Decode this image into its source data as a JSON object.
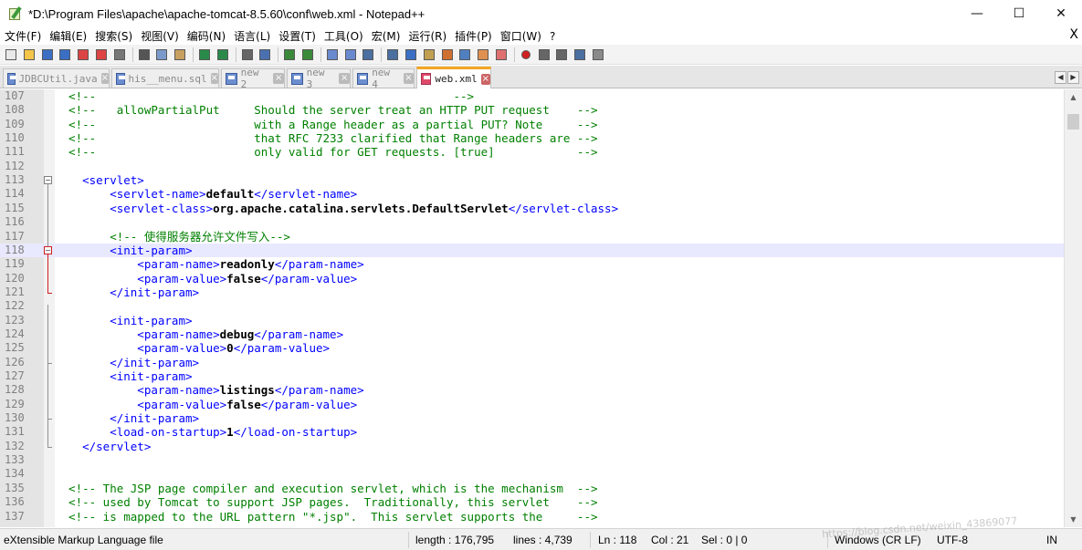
{
  "window": {
    "title": "*D:\\Program Files\\apache\\apache-tomcat-8.5.60\\conf\\web.xml - Notepad++",
    "minimize_glyph": "—",
    "maximize_glyph": "☐",
    "close_glyph": "✕"
  },
  "menu": {
    "items": [
      "文件(F)",
      "编辑(E)",
      "搜索(S)",
      "视图(V)",
      "编码(N)",
      "语言(L)",
      "设置(T)",
      "工具(O)",
      "宏(M)",
      "运行(R)",
      "插件(P)",
      "窗口(W)",
      "?"
    ],
    "close_label": "X"
  },
  "toolbar": {
    "icons": [
      "new-file-icon",
      "open-file-icon",
      "save-icon",
      "save-all-icon",
      "close-icon",
      "close-all-icon",
      "print-icon",
      "cut-icon",
      "copy-icon",
      "paste-icon",
      "undo-icon",
      "redo-icon",
      "find-icon",
      "replace-icon",
      "zoom-in-icon",
      "zoom-out-icon",
      "sync-vertical-icon",
      "sync-horizontal-icon",
      "word-wrap-icon",
      "show-all-chars-icon",
      "indent-guide-icon",
      "user-lang-icon",
      "doc-map-icon",
      "function-list-icon",
      "folder-workspace-icon",
      "monitor-icon",
      "record-macro-icon",
      "stop-macro-icon",
      "play-macro-icon",
      "run-macro-multiple-icon",
      "save-macro-icon"
    ]
  },
  "tabs": [
    {
      "label": "JDBCUtil.java",
      "active": false
    },
    {
      "label": "his__menu.sql",
      "active": false
    },
    {
      "label": "new 2",
      "active": false
    },
    {
      "label": "new 3",
      "active": false
    },
    {
      "label": "new 4",
      "active": false
    },
    {
      "label": "web.xml",
      "active": true
    }
  ],
  "editor": {
    "current_line": 118,
    "lines": [
      {
        "n": "107",
        "parts": [
          {
            "t": "  <!--                                                    -->",
            "c": "cmt"
          }
        ]
      },
      {
        "n": "108",
        "parts": [
          {
            "t": "  <!--   allowPartialPut     Should the server treat an HTTP PUT request    -->",
            "c": "cmt"
          }
        ]
      },
      {
        "n": "109",
        "parts": [
          {
            "t": "  <!--                       with a Range header as a partial PUT? Note     -->",
            "c": "cmt"
          }
        ]
      },
      {
        "n": "110",
        "parts": [
          {
            "t": "  <!--                       that RFC 7233 clarified that Range headers are -->",
            "c": "cmt"
          }
        ]
      },
      {
        "n": "111",
        "parts": [
          {
            "t": "  <!--                       only valid for GET requests. [true]            -->",
            "c": "cmt"
          }
        ]
      },
      {
        "n": "112",
        "parts": []
      },
      {
        "n": "113",
        "parts": [
          {
            "t": "    <servlet>",
            "c": "tag"
          }
        ]
      },
      {
        "n": "114",
        "parts": [
          {
            "t": "        <servlet-name>",
            "c": "tag"
          },
          {
            "t": "default",
            "c": "txt"
          },
          {
            "t": "</servlet-name>",
            "c": "tag"
          }
        ]
      },
      {
        "n": "115",
        "parts": [
          {
            "t": "        <servlet-class>",
            "c": "tag"
          },
          {
            "t": "org.apache.catalina.servlets.DefaultServlet",
            "c": "txt"
          },
          {
            "t": "</servlet-class>",
            "c": "tag"
          }
        ]
      },
      {
        "n": "116",
        "parts": []
      },
      {
        "n": "117",
        "parts": [
          {
            "t": "        <!-- 使得服务器允许文件写入-->",
            "c": "cmt"
          }
        ]
      },
      {
        "n": "118",
        "parts": [
          {
            "t": "        <init-param>",
            "c": "tag"
          }
        ]
      },
      {
        "n": "119",
        "parts": [
          {
            "t": "            <param-name>",
            "c": "tag"
          },
          {
            "t": "readonly",
            "c": "txt"
          },
          {
            "t": "</param-name>",
            "c": "tag"
          }
        ]
      },
      {
        "n": "120",
        "parts": [
          {
            "t": "            <param-value>",
            "c": "tag"
          },
          {
            "t": "false",
            "c": "txt"
          },
          {
            "t": "</param-value>",
            "c": "tag"
          }
        ]
      },
      {
        "n": "121",
        "parts": [
          {
            "t": "        </init-param>",
            "c": "tag"
          }
        ]
      },
      {
        "n": "122",
        "parts": []
      },
      {
        "n": "123",
        "parts": [
          {
            "t": "        <init-param>",
            "c": "tag"
          }
        ]
      },
      {
        "n": "124",
        "parts": [
          {
            "t": "            <param-name>",
            "c": "tag"
          },
          {
            "t": "debug",
            "c": "txt"
          },
          {
            "t": "</param-name>",
            "c": "tag"
          }
        ]
      },
      {
        "n": "125",
        "parts": [
          {
            "t": "            <param-value>",
            "c": "tag"
          },
          {
            "t": "0",
            "c": "txt"
          },
          {
            "t": "</param-value>",
            "c": "tag"
          }
        ]
      },
      {
        "n": "126",
        "parts": [
          {
            "t": "        </init-param>",
            "c": "tag"
          }
        ]
      },
      {
        "n": "127",
        "parts": [
          {
            "t": "        <init-param>",
            "c": "tag"
          }
        ]
      },
      {
        "n": "128",
        "parts": [
          {
            "t": "            <param-name>",
            "c": "tag"
          },
          {
            "t": "listings",
            "c": "txt"
          },
          {
            "t": "</param-name>",
            "c": "tag"
          }
        ]
      },
      {
        "n": "129",
        "parts": [
          {
            "t": "            <param-value>",
            "c": "tag"
          },
          {
            "t": "false",
            "c": "txt"
          },
          {
            "t": "</param-value>",
            "c": "tag"
          }
        ]
      },
      {
        "n": "130",
        "parts": [
          {
            "t": "        </init-param>",
            "c": "tag"
          }
        ]
      },
      {
        "n": "131",
        "parts": [
          {
            "t": "        <load-on-startup>",
            "c": "tag"
          },
          {
            "t": "1",
            "c": "txt"
          },
          {
            "t": "</load-on-startup>",
            "c": "tag"
          }
        ]
      },
      {
        "n": "132",
        "parts": [
          {
            "t": "    </servlet>",
            "c": "tag"
          }
        ]
      },
      {
        "n": "133",
        "parts": []
      },
      {
        "n": "134",
        "parts": []
      },
      {
        "n": "135",
        "parts": [
          {
            "t": "  <!-- The JSP page compiler and execution servlet, which is the mechanism  -->",
            "c": "cmt"
          }
        ]
      },
      {
        "n": "136",
        "parts": [
          {
            "t": "  <!-- used by Tomcat to support JSP pages.  Traditionally, this servlet    -->",
            "c": "cmt"
          }
        ]
      },
      {
        "n": "137",
        "parts": [
          {
            "t": "  <!-- is mapped to the URL pattern \"*.jsp\".  This servlet supports the     -->",
            "c": "cmt"
          }
        ]
      }
    ]
  },
  "status": {
    "file_type": "eXtensible Markup Language file",
    "length": "length : 176,795",
    "lines": "lines : 4,739",
    "ln": "Ln : 118",
    "col": "Col : 21",
    "sel": "Sel : 0 | 0",
    "eol": "Windows (CR LF)",
    "encoding": "UTF-8",
    "mode": "IN"
  },
  "watermark": "https://blog.csdn.net/weixin_43869077",
  "colors": {
    "comment": "#008000",
    "tag": "#0000ff",
    "text": "#000000",
    "current_line": "#e8e8ff",
    "active_tab_accent": "#f5a623"
  }
}
